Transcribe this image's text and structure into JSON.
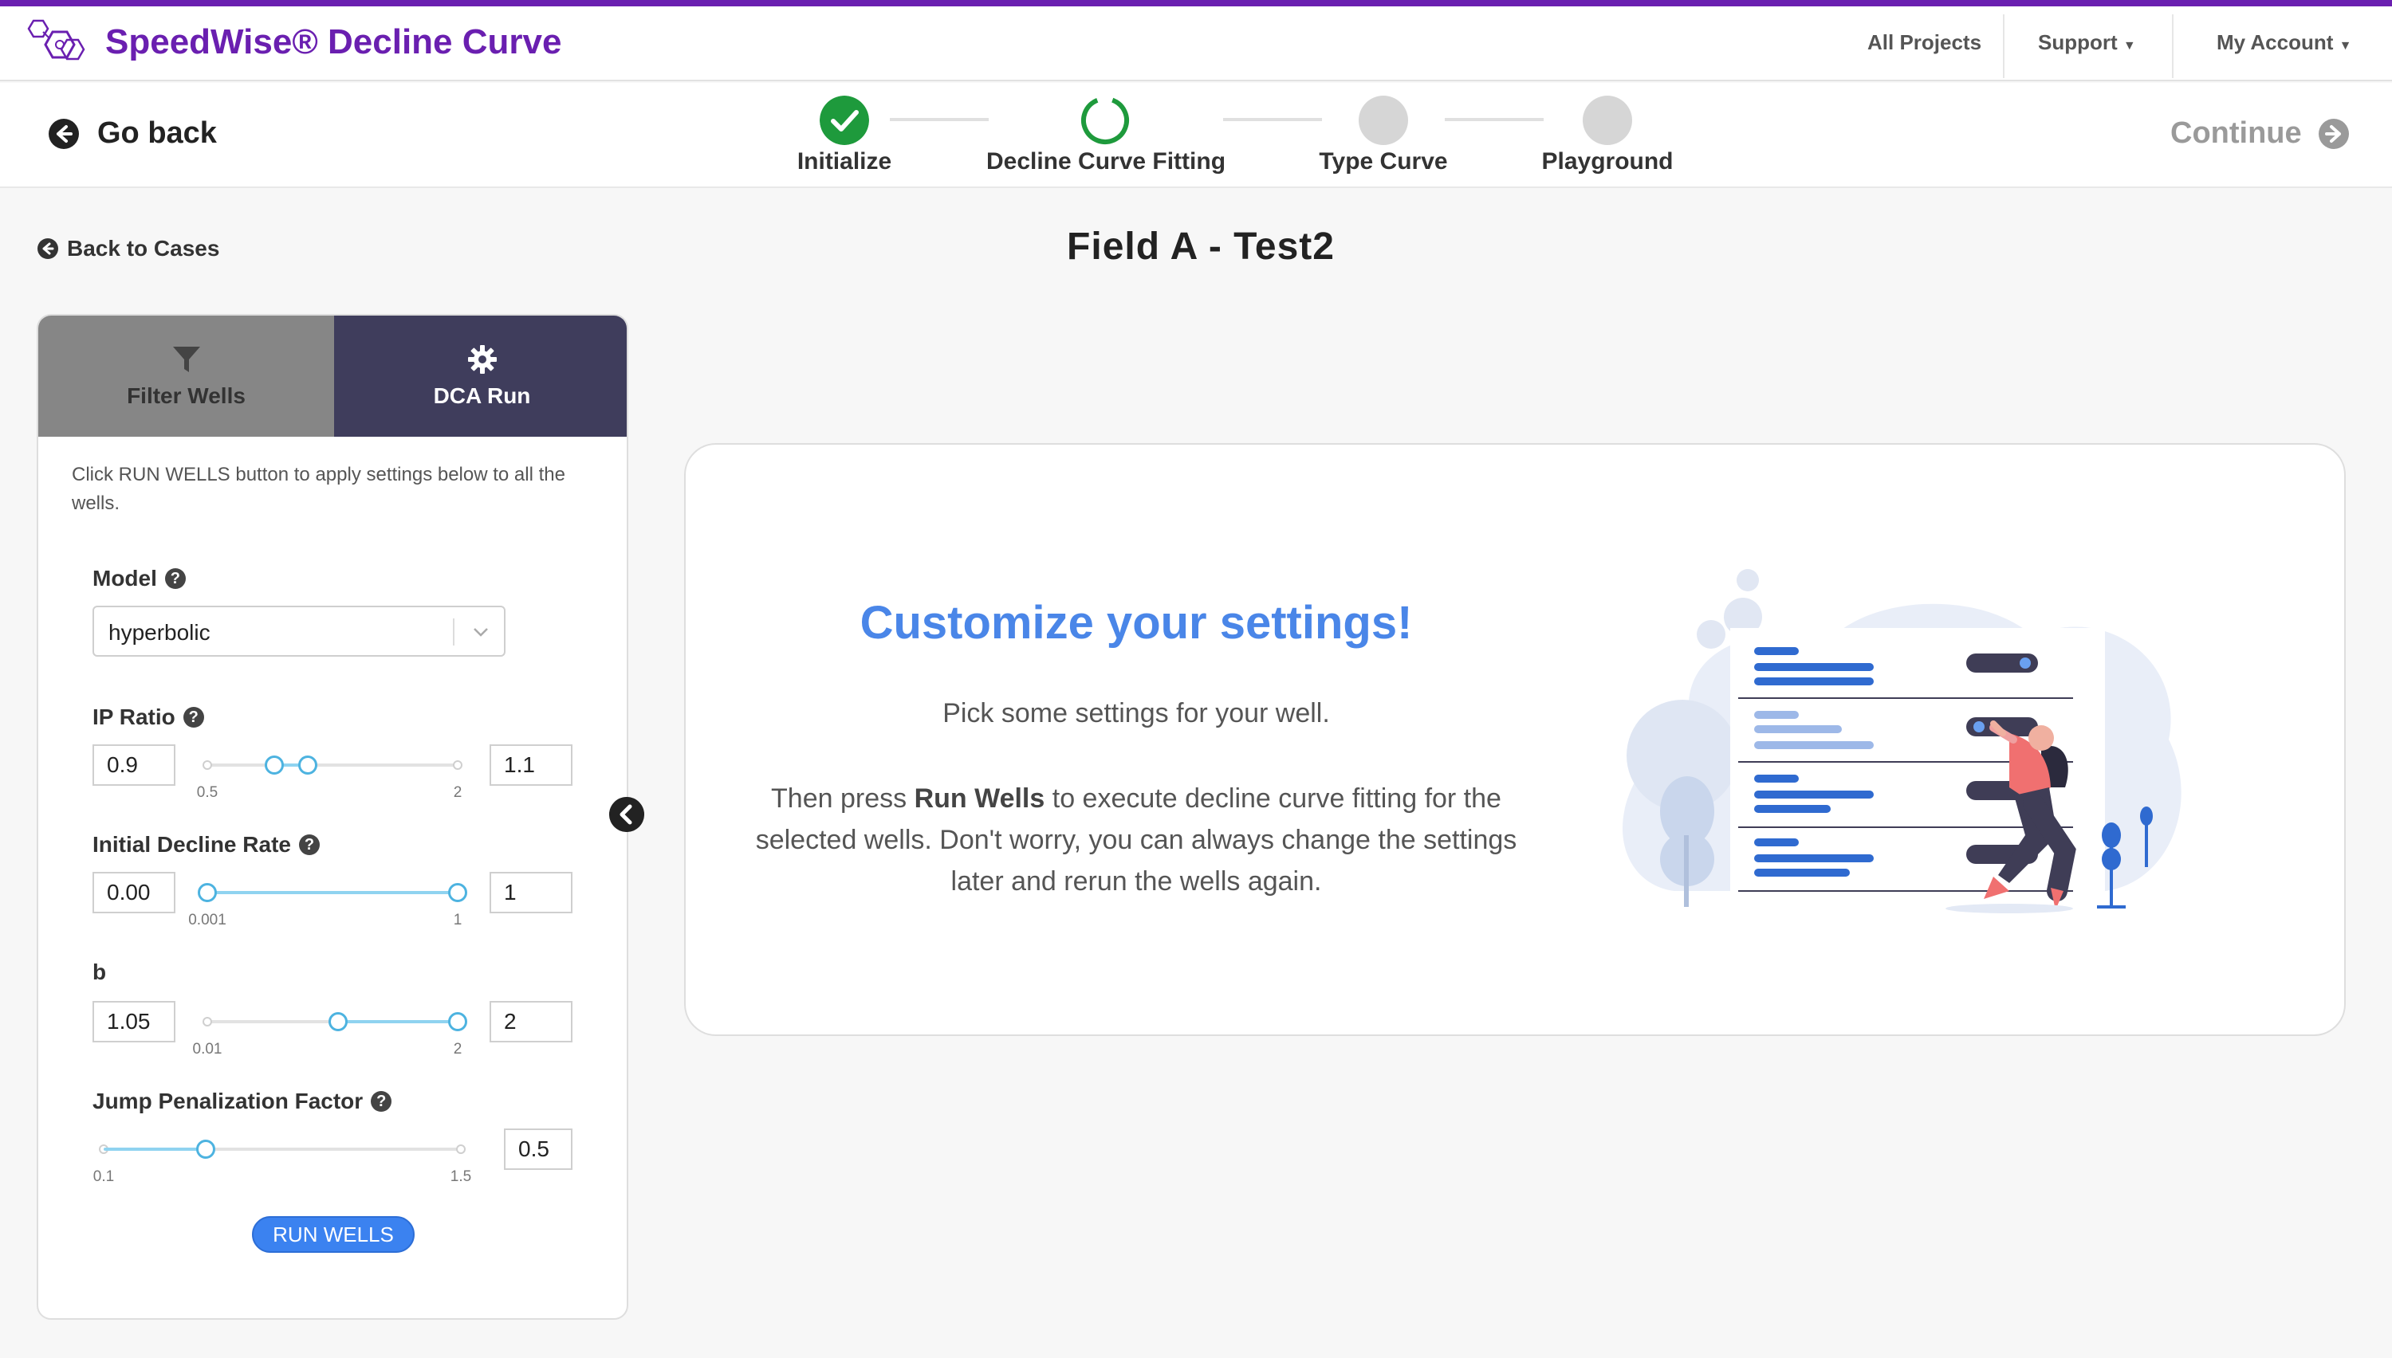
{
  "app": {
    "brand": "SpeedWise® Decline Curve",
    "logo_icon": "hexagon-molecule-logo-icon",
    "accent_color": "#6a1fb0"
  },
  "nav": {
    "all_projects": "All Projects",
    "support": "Support",
    "my_account": "My Account"
  },
  "steps": {
    "go_back": "Go back",
    "continue": "Continue",
    "items": [
      {
        "label": "Initialize",
        "state": "complete"
      },
      {
        "label": "Decline Curve Fitting",
        "state": "in-progress"
      },
      {
        "label": "Type Curve",
        "state": "pending"
      },
      {
        "label": "Playground",
        "state": "pending"
      }
    ]
  },
  "page": {
    "back_to_cases": "Back to Cases",
    "title": "Field A - Test2"
  },
  "panel": {
    "tabs": [
      {
        "label": "Filter Wells",
        "icon": "filter-icon",
        "active": false
      },
      {
        "label": "DCA Run",
        "icon": "gear-icon",
        "active": true
      }
    ],
    "hint": "Click RUN WELLS button to apply settings below to all the wells.",
    "model": {
      "label": "Model",
      "value": "hyperbolic"
    },
    "ip_ratio": {
      "label": "IP Ratio",
      "min_value": "0.9",
      "max_value": "1.1",
      "range_min": "0.5",
      "range_max": "2",
      "low": 0.9,
      "high": 1.1,
      "lo": 0.5,
      "hi": 2
    },
    "initial_decline_rate": {
      "label": "Initial Decline Rate",
      "min_value": "0.00",
      "max_value": "1",
      "range_min": "0.001",
      "range_max": "1",
      "low": 0.001,
      "high": 1,
      "lo": 0.001,
      "hi": 1
    },
    "b": {
      "label": "b",
      "min_value": "1.05",
      "max_value": "2",
      "range_min": "0.01",
      "range_max": "2",
      "low": 1.05,
      "high": 2,
      "lo": 0.01,
      "hi": 2
    },
    "jump_penalization": {
      "label": "Jump Penalization Factor",
      "value": "0.5",
      "range_min": "0.1",
      "range_max": "1.5",
      "val": 0.5,
      "lo": 0.1,
      "hi": 1.5
    },
    "run_button": "RUN WELLS"
  },
  "card": {
    "title": "Customize your settings!",
    "subtitle": "Pick some settings for your well.",
    "body_pre": "Then press ",
    "body_bold": "Run Wells",
    "body_post": " to execute decline curve fitting for the selected wells. Don't worry, you can always change the settings later and rerun the wells again."
  }
}
